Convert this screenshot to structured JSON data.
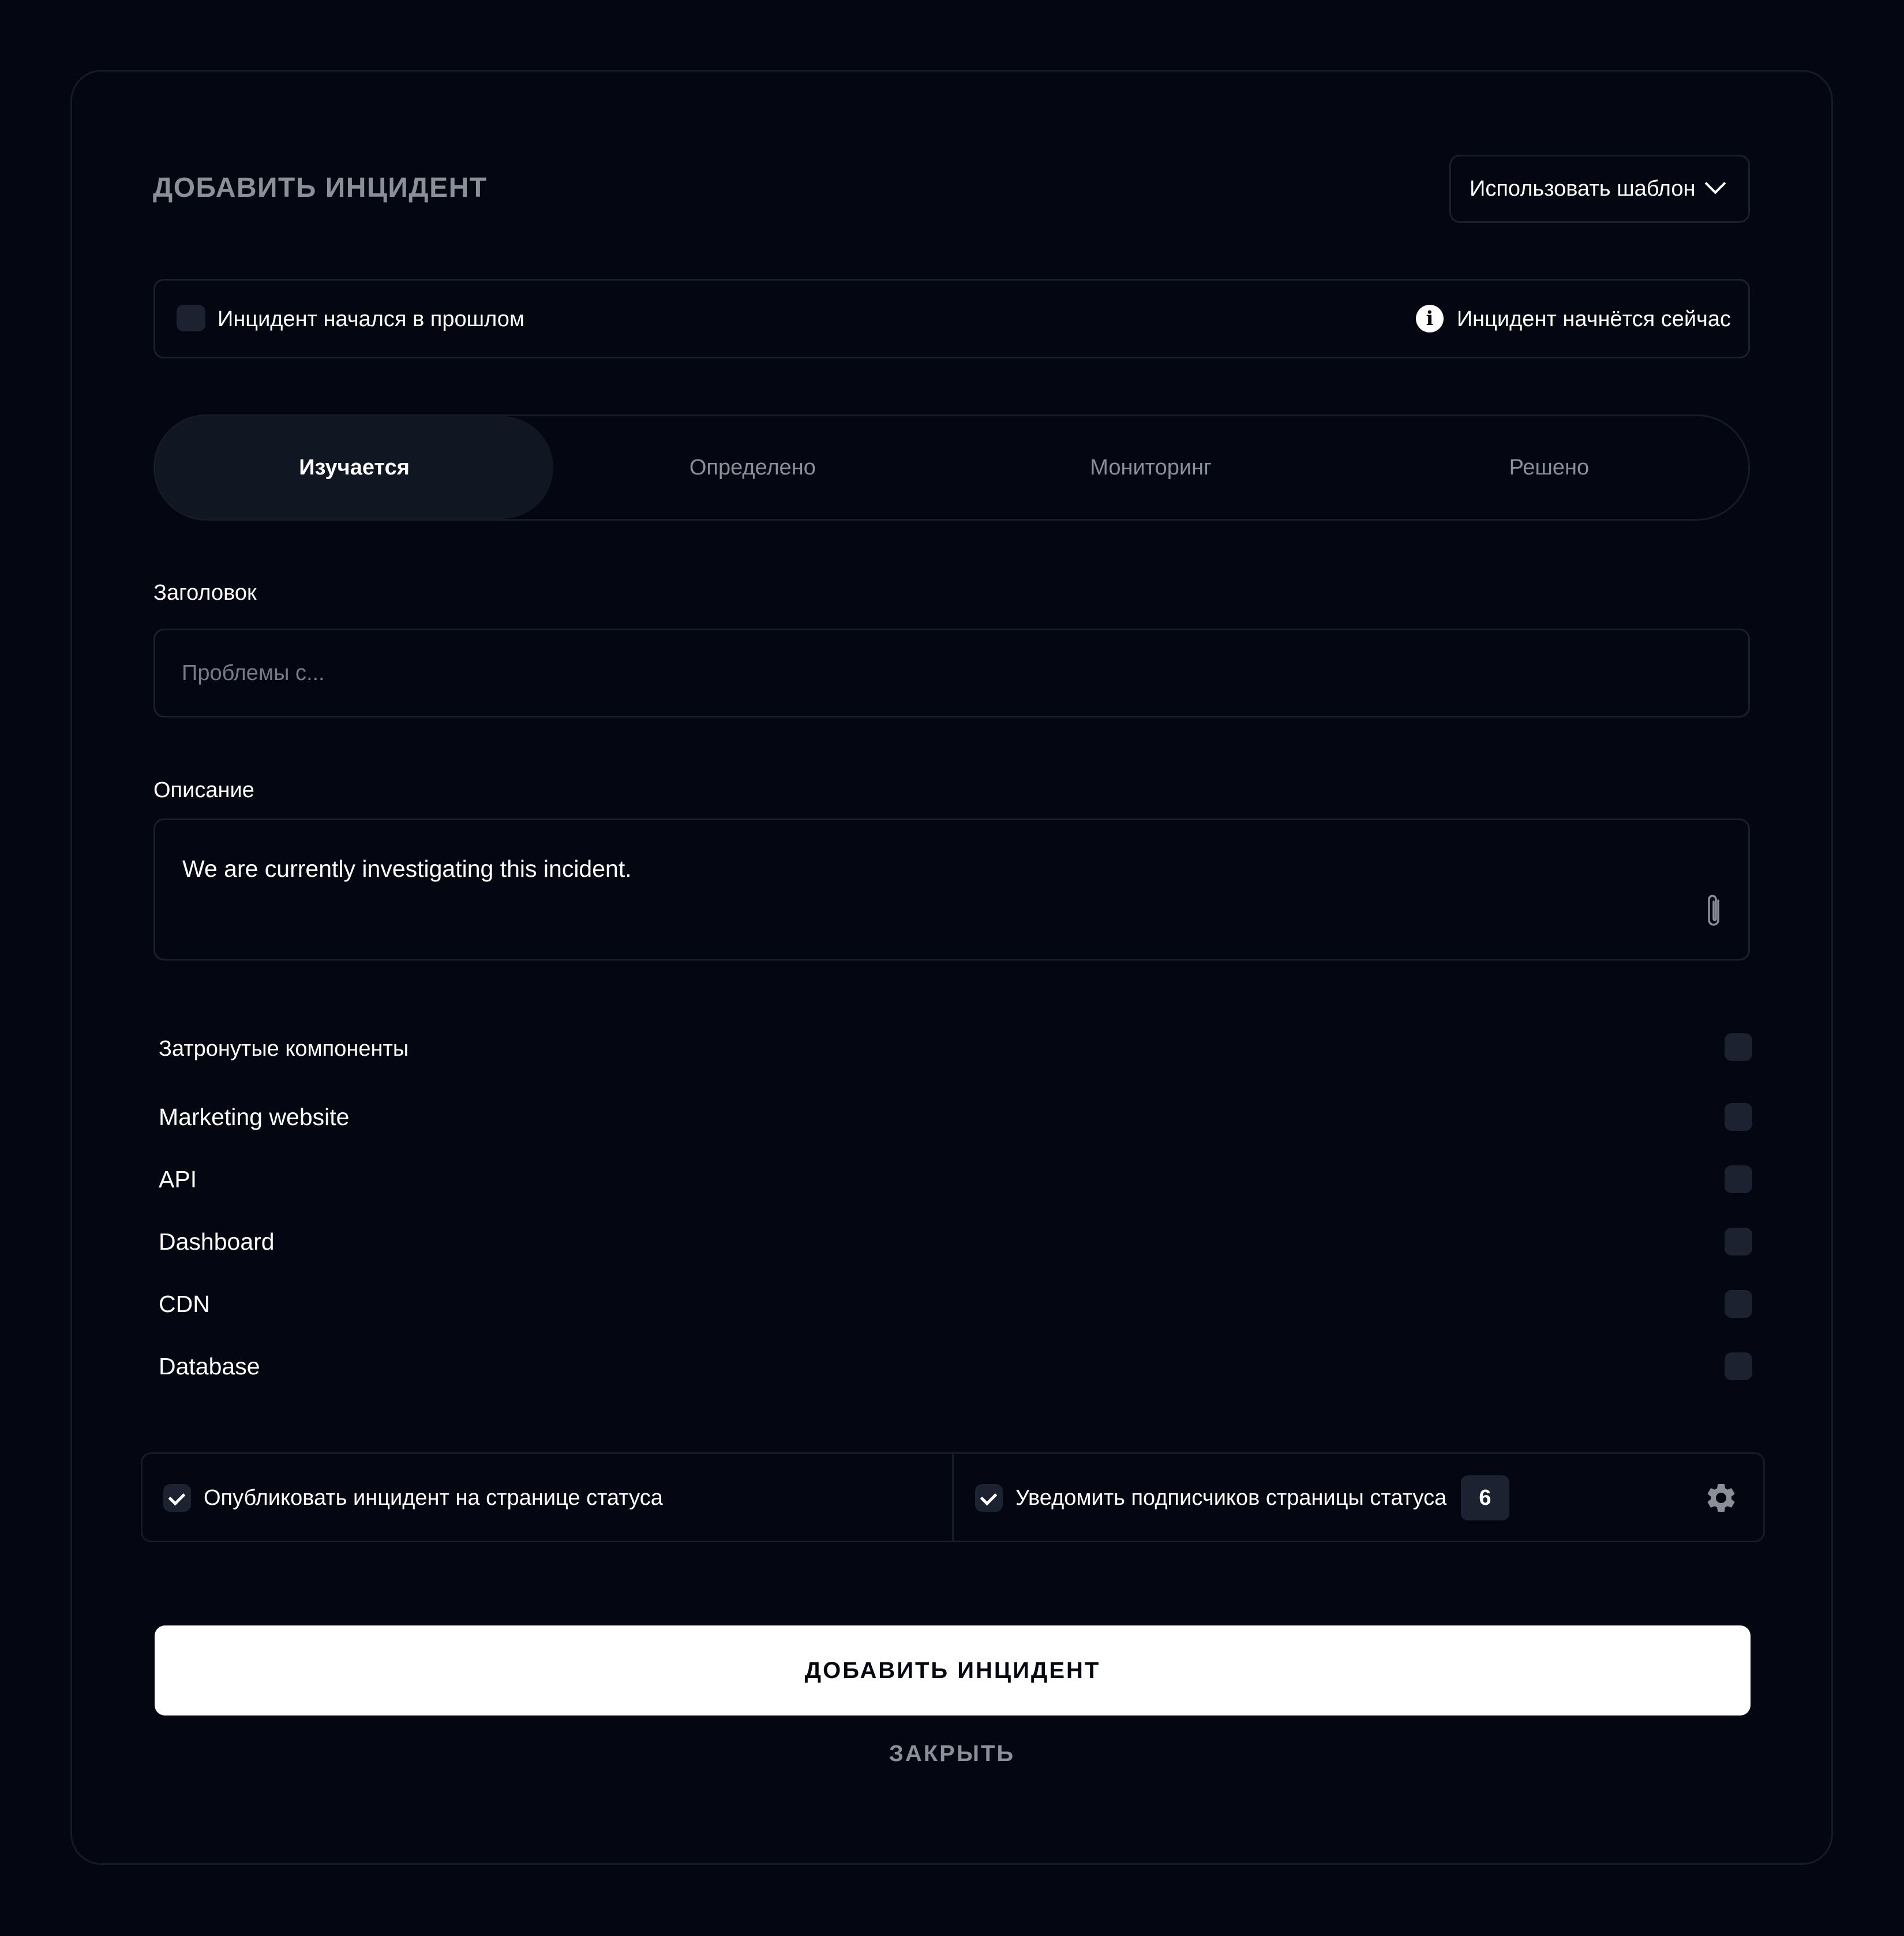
{
  "modal": {
    "title": "ДОБАВИТЬ ИНЦИДЕНТ",
    "template_button_label": "Использовать шаблон"
  },
  "start_time": {
    "past_label": "Инцидент начался в прошлом",
    "now_label": "Инцидент начнётся сейчас"
  },
  "status_tabs": [
    {
      "label": "Изучается",
      "active": true
    },
    {
      "label": "Определено",
      "active": false
    },
    {
      "label": "Мониторинг",
      "active": false
    },
    {
      "label": "Решено",
      "active": false
    }
  ],
  "title_field": {
    "label": "Заголовок",
    "placeholder": "Проблемы с...",
    "value": ""
  },
  "description_field": {
    "label": "Описание",
    "value": "We are currently investigating this incident."
  },
  "components": {
    "label": "Затронутые компоненты",
    "items": [
      {
        "name": "Marketing website"
      },
      {
        "name": "API"
      },
      {
        "name": "Dashboard"
      },
      {
        "name": "CDN"
      },
      {
        "name": "Database"
      }
    ]
  },
  "notify": {
    "publish_label": "Опубликовать инцидент на странице статуса",
    "publish_checked": true,
    "subscribers_label": "Уведомить подписчиков страницы статуса",
    "subscribers_checked": true,
    "subscribers_count": "6"
  },
  "actions": {
    "submit_label": "ДОБАВИТЬ ИНЦИДЕНТ",
    "close_label": "ЗАКРЫТЬ"
  },
  "colors": {
    "background": "#040711",
    "border": "#1b202c",
    "active_tab": "#111722",
    "muted_text": "#8b8f98"
  }
}
